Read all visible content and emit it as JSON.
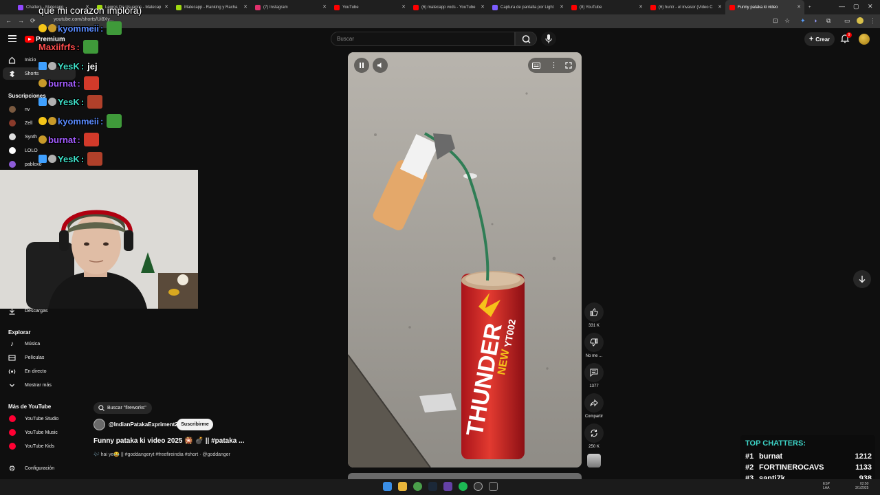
{
  "browser": {
    "tabs": [
      {
        "label": "Chatters - Matecapp",
        "color": "#9147ff"
      },
      {
        "label": "Logros De Usuarios - Matecap",
        "color": "#a0d911"
      },
      {
        "label": "Matecapp - Ranking y Racha",
        "color": "#a0d911"
      },
      {
        "label": "(7) Instagram",
        "color": "#e1306c"
      },
      {
        "label": "YouTube",
        "color": "#ff0000"
      },
      {
        "label": "(6) matecapp vods - YouTube",
        "color": "#ff0000"
      },
      {
        "label": "Captura de pantalla por Light",
        "color": "#7b5cff"
      },
      {
        "label": "(8) YouTube",
        "color": "#ff0000"
      },
      {
        "label": "(6) huntr - el invasor (Video C",
        "color": "#ff0000"
      },
      {
        "label": "Funny pataka ki video",
        "color": "#ff0000",
        "active": true
      }
    ],
    "url": "youtube.com/shorts/Ui8Xy..."
  },
  "header": {
    "brand": "Premium",
    "search_placeholder": "Buscar",
    "create_label": "Crear",
    "notif_count": "9"
  },
  "sidebar": {
    "main": [
      {
        "label": "Inicio",
        "icon": "home-icon"
      },
      {
        "label": "Shorts",
        "icon": "shorts-icon",
        "active": true
      }
    ],
    "subs_heading": "Suscripciones",
    "subs": [
      {
        "label": "nv",
        "color": "#7a5a40"
      },
      {
        "label": "Zell",
        "color": "#8a3a2a"
      },
      {
        "label": "Synth",
        "color": "#dddddd"
      },
      {
        "label": "LOLO",
        "color": "#ffffff"
      },
      {
        "label": "pabloxo",
        "color": "#8e5cd9"
      }
    ],
    "downloads": "Descargas",
    "explore_heading": "Explorar",
    "explore": [
      {
        "label": "Música",
        "icon": "music-icon"
      },
      {
        "label": "Películas",
        "icon": "movies-icon"
      },
      {
        "label": "En directo",
        "icon": "live-icon"
      },
      {
        "label": "Mostrar más",
        "icon": "chevron-down-icon"
      }
    ],
    "more_heading": "Más de YouTube",
    "more": [
      {
        "label": "YouTube Studio"
      },
      {
        "label": "YouTube Music"
      },
      {
        "label": "YouTube Kids"
      }
    ],
    "settings": "Configuración"
  },
  "chat": {
    "title": "que mi corazon implora)",
    "lines": [
      {
        "user": "kyommeii",
        "text": "",
        "color": "#5b8cff"
      },
      {
        "user": "Maxiifrfs",
        "text": "",
        "color": "#ff4d4d"
      },
      {
        "user": "YesK",
        "text": "jej",
        "color": "#3ee0c8"
      },
      {
        "user": "burnat",
        "text": "",
        "color": "#a35cff"
      },
      {
        "user": "YesK",
        "text": "",
        "color": "#3ee0c8"
      },
      {
        "user": "kyommeii",
        "text": "",
        "color": "#5b8cff"
      },
      {
        "user": "burnat",
        "text": "",
        "color": "#a35cff"
      },
      {
        "user": "YesK",
        "text": "",
        "color": "#3ee0c8"
      }
    ]
  },
  "video": {
    "firework_text": "THUNDER",
    "firework_sub": "NEW",
    "firework_code": "YT002"
  },
  "actions": {
    "likes": "331 K",
    "dislike": "No me ...",
    "comments": "1377",
    "share": "Compartir",
    "remix": "250 K"
  },
  "meta": {
    "search_chip": "Buscar \"fireworks\"",
    "channel": "@IndianPatakaExpriment2",
    "subscribe": "Suscribirme",
    "title": "Funny pataka ki video 2025 🎇 💣 || #pataka ...",
    "desc": "🎶 hai ye😂 || #goddangeryt #freefireindia #short · @goddanger"
  },
  "top_chatters": {
    "title": "TOP CHATTERS:",
    "rows": [
      {
        "rank": "#1",
        "name": "burnat",
        "count": "1212"
      },
      {
        "rank": "#2",
        "name": "FORTINEROCAVS",
        "count": "1133"
      },
      {
        "rank": "#3",
        "name": "santi7k",
        "count": "938"
      }
    ]
  },
  "taskbar": {
    "tray_lang": "ESP",
    "tray_region": "LAA",
    "time": "02:50",
    "date": "3/1/2025"
  }
}
